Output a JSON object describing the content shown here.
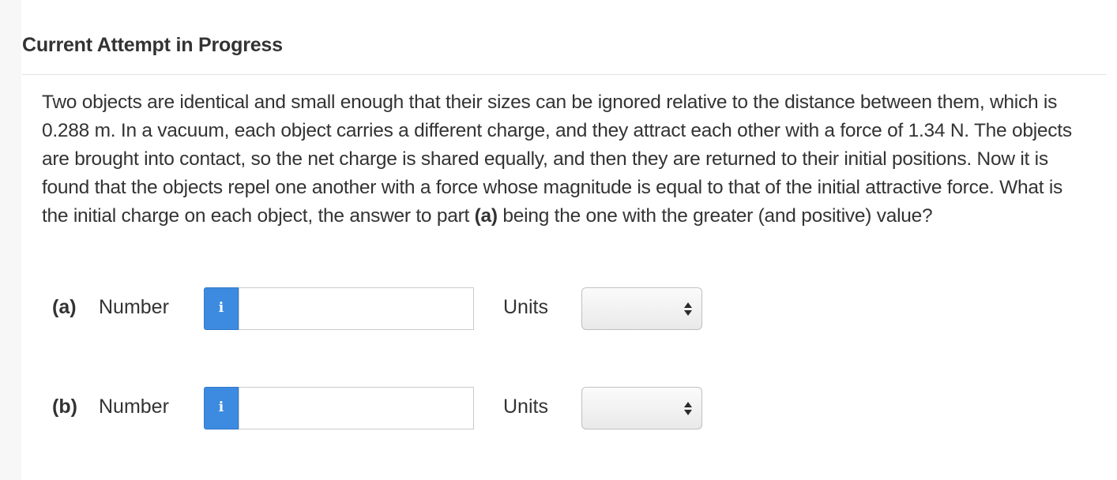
{
  "header": {
    "title": "Current Attempt in Progress"
  },
  "question": {
    "text_before_a": "Two objects are identical and small enough that their sizes can be ignored relative to the distance between them, which is 0.288 m. In a vacuum, each object carries a different charge, and they attract each other with a force of 1.34 N. The objects are brought into contact, so the net charge is shared equally, and then they are returned to their initial positions. Now it is found that the objects repel one another with a force whose magnitude is equal to that of the initial attractive force. What is the initial charge on each object, the answer to part ",
    "part_ref": "(a)",
    "text_after_a": " being the one with the greater (and positive) value?"
  },
  "answers": [
    {
      "part_label": "(a)",
      "number_label": "Number",
      "info_glyph": "i",
      "info_icon": "info-icon",
      "number_value": "",
      "units_label": "Units",
      "units_selected": ""
    },
    {
      "part_label": "(b)",
      "number_label": "Number",
      "info_glyph": "i",
      "info_icon": "info-icon",
      "number_value": "",
      "units_label": "Units",
      "units_selected": ""
    }
  ],
  "colors": {
    "info_button": "#3d8be0",
    "text": "#333333",
    "divider": "#e2e2e2"
  }
}
